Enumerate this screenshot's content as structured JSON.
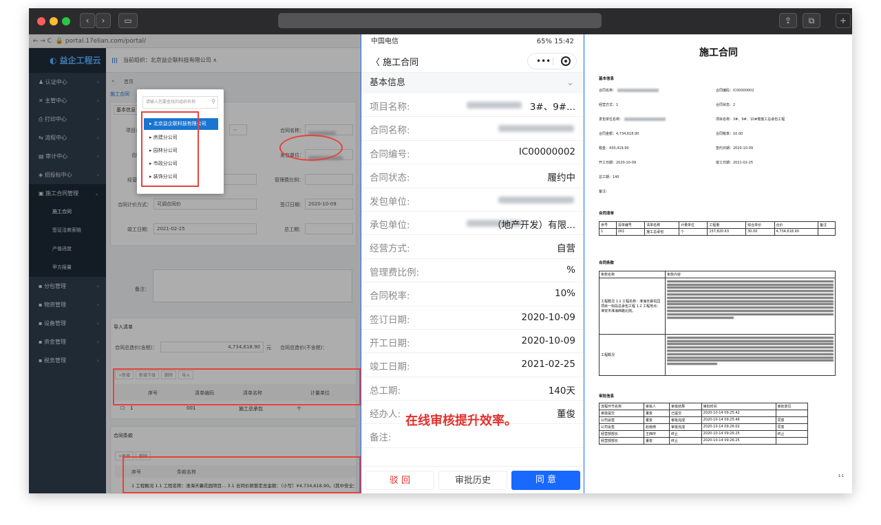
{
  "browser": {
    "url": "portal.17elian.com/portal/"
  },
  "admin": {
    "logo": "益企工程云",
    "org_label": "当前组织：北京益企联科技有限公司",
    "sidebar": [
      {
        "label": "认证中心"
      },
      {
        "label": "主管中心"
      },
      {
        "label": "打印中心"
      },
      {
        "label": "流程中心"
      },
      {
        "label": "审计中心"
      },
      {
        "label": "招投标中心"
      },
      {
        "label": "施工合同管理"
      }
    ],
    "sidebar_sub": [
      {
        "label": "施工合同"
      },
      {
        "label": "签证洽商索赔"
      },
      {
        "label": "产值进度"
      },
      {
        "label": "甲方报量"
      }
    ],
    "sidebar_more": [
      {
        "label": "分包管理"
      },
      {
        "label": "物资管理"
      },
      {
        "label": "设备管理"
      },
      {
        "label": "资金管理"
      },
      {
        "label": "税务管理"
      }
    ],
    "tab_home": "首页",
    "breadcrumb": "施工合同",
    "section_basic": "基本信息",
    "labels": {
      "project": "项目名称：",
      "contract_name": "合同名称：",
      "client": "合同方：",
      "issuer": "发包单位：",
      "mode": "经营方式：",
      "mgmt": "管理费比例：",
      "pricing": "合同计价方式：",
      "sign": "签订日期：",
      "finish": "竣工日期：",
      "total": "总工期：",
      "remark": "备注："
    },
    "values": {
      "mode": "自营",
      "pricing": "可调合同价",
      "sign": "2020-10-09",
      "finish": "2021-02-25"
    },
    "section_items": "导入清单",
    "sum_label": "合同总造价(含税)：",
    "sum_value": "4,734,618.90",
    "sum_unit": "元",
    "sum_label2": "合同总造价(不含税)：",
    "toolbar": [
      "+新增",
      "新增下级",
      "删除",
      "导入"
    ],
    "table_head": [
      "序号",
      "清单编码",
      "清单名称",
      "计量单位"
    ],
    "table_row": [
      "1",
      "001",
      "施工总承包",
      "个"
    ],
    "section_terms": "合同条款",
    "terms_toolbar": [
      "+新增",
      "删除"
    ],
    "terms_head": [
      "序号",
      "条款名称"
    ],
    "terms_row": "1  工程概况  1.1 工程名称：淮海天襄花园项目...  3.1 合同价款暂定总金额：（小写）¥4,734,618.90。(其中安全文明",
    "popup": {
      "placeholder": "请输入您要查找的组织名称",
      "items": [
        "北京益企联科技有限公司",
        "房建分公司",
        "园林分公司",
        "市政分公司",
        "装饰分公司"
      ]
    }
  },
  "phone": {
    "carrier": "中国电信",
    "status_right": "65%  15:42",
    "title": "施工合同",
    "capsule_more": "•••",
    "section": "基本信息",
    "rows": [
      {
        "label": "项目名称:",
        "value": "3#、9#...",
        "blur": true
      },
      {
        "label": "合同名称:",
        "value": "",
        "blur": true
      },
      {
        "label": "合同编号:",
        "value": "IC00000002"
      },
      {
        "label": "合同状态:",
        "value": "履约中"
      },
      {
        "label": "发包单位:",
        "value": "",
        "blur": true
      },
      {
        "label": "承包单位:",
        "value": "（地产开发）有限...",
        "blur": true
      },
      {
        "label": "经营方式:",
        "value": "自营"
      },
      {
        "label": "管理费比例:",
        "value": "%"
      },
      {
        "label": "合同税率:",
        "value": "10%"
      },
      {
        "label": "签订日期:",
        "value": "2020-10-09"
      },
      {
        "label": "开工日期:",
        "value": "2020-10-09"
      },
      {
        "label": "竣工日期:",
        "value": "2021-02-25"
      },
      {
        "label": "总工期:",
        "value": "140天"
      },
      {
        "label": "经办人:",
        "value": "董俊"
      },
      {
        "label": "备注:",
        "value": ""
      }
    ],
    "banner": "在线审核提升效率。",
    "buttons": {
      "reject": "驳 回",
      "history": "审批历史",
      "approve": "同 意"
    }
  },
  "doc": {
    "title": "施工合同",
    "sec_basic": "基本信息",
    "basic_left": [
      "合同名称：",
      "经营方式：1",
      "发包单位名称：",
      "合同金额：4,734,618.90",
      "税金：430,419.90",
      "开工日期：2020-10-09",
      "总工期：140",
      "备注："
    ],
    "basic_right": [
      "合同编码：IC00000002",
      "合同状态：2",
      "项目名称：3#、9#、10#楼施工总承包工程",
      "合同税率：10.00",
      "签约日期：2020-10-09",
      "竣工日期：2021-02-25"
    ],
    "sec_items": "合同清单",
    "items_head": [
      "序号",
      "清单编号",
      "清单名称",
      "计量单位",
      "工程量",
      "综合单价",
      "合价",
      "备注"
    ],
    "items_row": [
      "1",
      "001",
      "施工总承包",
      "个",
      "157,820.63",
      "30.00",
      "4,734,618.90",
      ""
    ],
    "sec_terms": "合同条款",
    "terms_head": [
      "条款名称",
      "条款内容"
    ],
    "terms_rows": [
      {
        "name": "工程概况 1.1 工程名称：淮海天襄花园项目一标段总承包工程 1.2 工程地点：淮安市淮海西路北侧。"
      },
      {
        "name": "工程概况"
      }
    ],
    "sec_approval": "审批信息",
    "approval_head": [
      "流程环节名称",
      "审批人",
      "审批结果",
      "审批时间",
      "审批意见"
    ],
    "approval_rows": [
      [
        "审批提交",
        "董俊",
        "已提交",
        "2020-10-14 09:25:42",
        ""
      ],
      [
        "公司会签",
        "董俊",
        "审批完成",
        "2020-10-14 09:25:46",
        "同意"
      ],
      [
        "公司会签",
        "赵雨琦",
        "审批完成",
        "2020-10-14 09:26:02",
        "同意"
      ],
      [
        "经营部部长",
        "王西环",
        "终止",
        "2020-10-14 09:26:25",
        "终止"
      ],
      [
        "经营部部长",
        "董俊",
        "终止",
        "2020-10-14 09:26:25",
        ""
      ]
    ],
    "page_no": "1-1"
  }
}
